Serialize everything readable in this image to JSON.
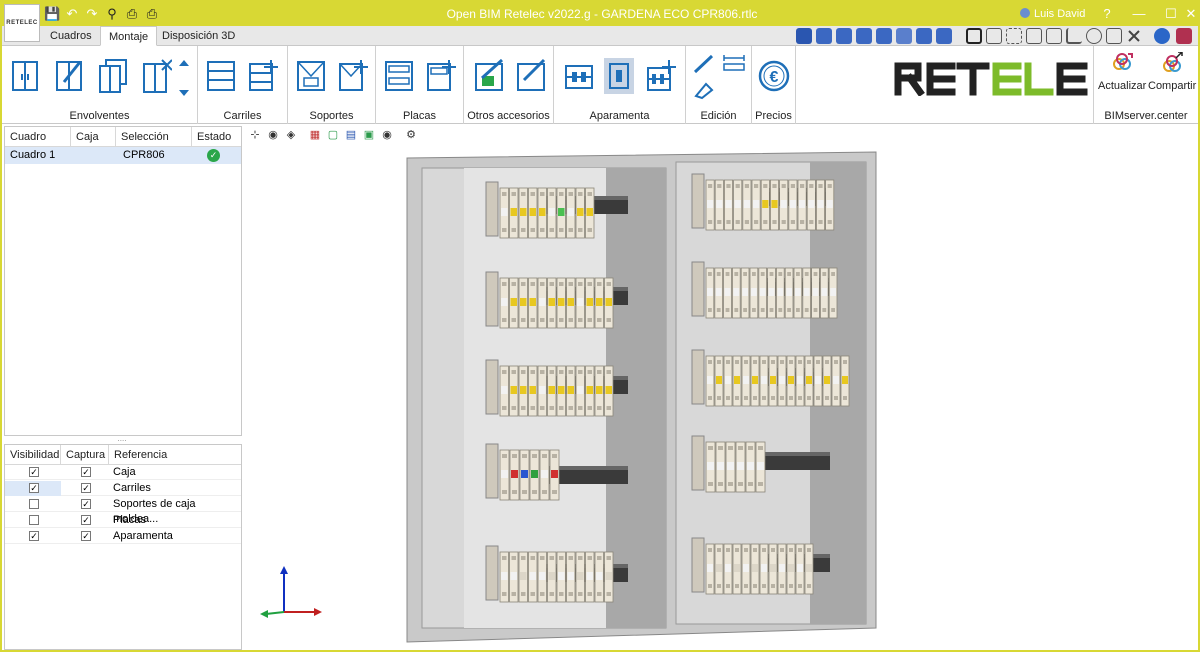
{
  "window": {
    "title": "Open BIM Retelec v2022.g - GARDENA ECO CPR806.rtlc",
    "user": "Luis David",
    "logo_text": "RETELEC"
  },
  "tabs": [
    {
      "label": "Cuadros"
    },
    {
      "label": "Montaje"
    },
    {
      "label": "Disposición 3D"
    }
  ],
  "ribbon": {
    "groups": [
      {
        "label": "Envolventes"
      },
      {
        "label": "Carriles"
      },
      {
        "label": "Soportes"
      },
      {
        "label": "Placas"
      },
      {
        "label": "Otros accesorios"
      },
      {
        "label": "Aparamenta"
      },
      {
        "label": "Edición"
      },
      {
        "label": "Precios"
      },
      {
        "label": "BIMserver.center"
      }
    ],
    "actualizar_label": "Actualizar",
    "compartir_label": "Compartir",
    "brand_text": "RETELEC"
  },
  "cuadros_table": {
    "headers": [
      "Cuadro",
      "Caja",
      "Selección",
      "Estado"
    ],
    "rows": [
      {
        "cuadro": "Cuadro 1",
        "caja": "",
        "seleccion": "CPR806",
        "estado": "ok"
      }
    ]
  },
  "layers_table": {
    "headers": [
      "Visibilidad",
      "Captura",
      "Referencia"
    ],
    "rows": [
      {
        "visible": true,
        "captura": true,
        "referencia": "Caja"
      },
      {
        "visible": true,
        "captura": true,
        "referencia": "Carriles"
      },
      {
        "visible": false,
        "captura": true,
        "referencia": "Soportes de caja moldea..."
      },
      {
        "visible": false,
        "captura": true,
        "referencia": "Placas"
      },
      {
        "visible": true,
        "captura": true,
        "referencia": "Aparamenta"
      }
    ]
  },
  "colors": {
    "frame": "#d8d834",
    "accent_blue": "#1e6fb8",
    "selection": "#dce8f8",
    "status_ok": "#2aa64a"
  }
}
